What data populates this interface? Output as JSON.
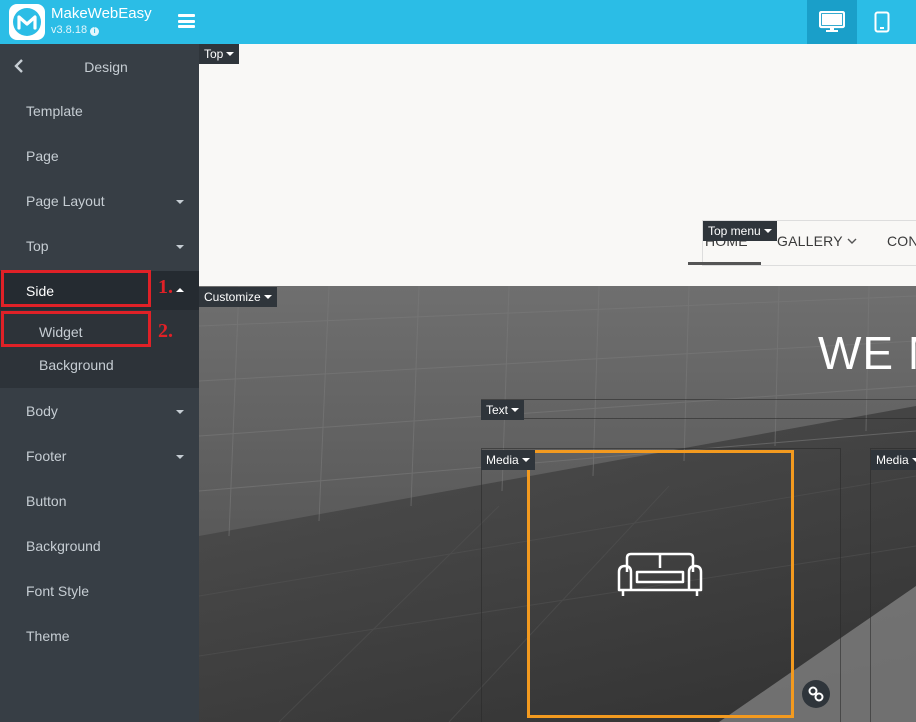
{
  "app": {
    "name": "MakeWebEasy",
    "version": "v3.8.18",
    "colors": {
      "topbar": "#2bbde6",
      "sidebar": "#373e45",
      "highlight": "#e02127",
      "selection": "#f39a1f"
    }
  },
  "toolbar": {
    "menu_icon": "hamburger-icon",
    "devices": [
      {
        "name": "desktop",
        "icon": "desktop-icon",
        "active": true
      },
      {
        "name": "mobile",
        "icon": "mobile-icon",
        "active": false
      }
    ]
  },
  "sidebar": {
    "title": "Design",
    "items": [
      {
        "label": "Template",
        "has_caret": false
      },
      {
        "label": "Page",
        "has_caret": false
      },
      {
        "label": "Page Layout",
        "has_caret": true
      },
      {
        "label": "Top",
        "has_caret": true
      },
      {
        "label": "Side",
        "has_caret": true,
        "expanded": true
      },
      {
        "label": "Body",
        "has_caret": true
      },
      {
        "label": "Footer",
        "has_caret": true
      },
      {
        "label": "Button",
        "has_caret": false
      },
      {
        "label": "Background",
        "has_caret": false
      },
      {
        "label": "Font Style",
        "has_caret": false
      },
      {
        "label": "Theme",
        "has_caret": false
      }
    ],
    "side_subitems": [
      {
        "label": "Widget"
      },
      {
        "label": "Background"
      }
    ]
  },
  "annotations": {
    "step1": "1.",
    "step2": "2."
  },
  "canvas": {
    "tags": {
      "top": "Top",
      "top_menu": "Top menu",
      "customize": "Customize",
      "text": "Text",
      "media1": "Media",
      "media2": "Media"
    },
    "menu": [
      "HOME",
      "GALLERY",
      "CON"
    ],
    "hero_title": "WE M",
    "media_icon": "sofa-icon",
    "link_icon": "link-icon"
  }
}
